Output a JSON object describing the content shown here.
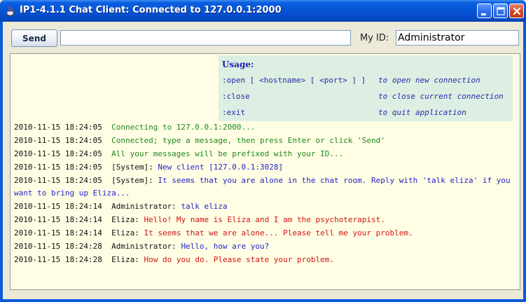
{
  "window": {
    "title": "IP1-4.1.1 Chat Client: Connected to 127.0.0.1:2000"
  },
  "toolbar": {
    "send_label": "Send",
    "message_value": "",
    "my_id_label": "My ID:",
    "my_id_value": "Administrator"
  },
  "usage": {
    "title": "Usage:",
    "rows": [
      {
        "command": ":open [ <hostname> [ <port> ] ]",
        "description": "to open new connection"
      },
      {
        "command": ":close",
        "description": "to close current connection"
      },
      {
        "command": ":exit",
        "description": "to quit application"
      }
    ]
  },
  "log": [
    {
      "timestamp": "2010-11-15 18:24:05",
      "sender": "",
      "text": "Connecting to 127.0.0.1:2000...",
      "color": "green"
    },
    {
      "timestamp": "2010-11-15 18:24:05",
      "sender": "",
      "text": "Connected; type a message, then press Enter or click 'Send'",
      "color": "green"
    },
    {
      "timestamp": "2010-11-15 18:24:05",
      "sender": "",
      "text": "All your messages will be prefixed with your ID...",
      "color": "green"
    },
    {
      "timestamp": "2010-11-15 18:24:05",
      "sender": "[System]:",
      "text": "New client [127.0.0.1:3028]",
      "color": "blue"
    },
    {
      "timestamp": "2010-11-15 18:24:05",
      "sender": "[System]:",
      "text": "It seems that you are alone in the chat room. Reply with 'talk eliza' if you want to bring up Eliza...",
      "color": "blue"
    },
    {
      "timestamp": "2010-11-15 18:24:14",
      "sender": "Administrator:",
      "text": "talk eliza",
      "color": "blue"
    },
    {
      "timestamp": "2010-11-15 18:24:14",
      "sender": "Eliza:",
      "text": "Hello! My name is Eliza and I am the psychoterapist.",
      "color": "red"
    },
    {
      "timestamp": "2010-11-15 18:24:14",
      "sender": "Eliza:",
      "text": "It seems that we are alone... Please tell me your problem.",
      "color": "red"
    },
    {
      "timestamp": "2010-11-15 18:24:28",
      "sender": "Administrator:",
      "text": "Hello, how are you?",
      "color": "blue"
    },
    {
      "timestamp": "2010-11-15 18:24:28",
      "sender": "Eliza:",
      "text": "How do you do. Please state your problem.",
      "color": "red"
    }
  ],
  "colors": {
    "green": "#1e8a1e",
    "blue": "#2626c8",
    "red": "#d01414",
    "chat_background": "#fffde4",
    "usage_background": "#dcefe2",
    "titlebar": "#0754d6"
  },
  "icons": {
    "app": "java-cup-icon",
    "minimize": "minimize-icon",
    "maximize": "maximize-icon",
    "close": "close-icon"
  }
}
